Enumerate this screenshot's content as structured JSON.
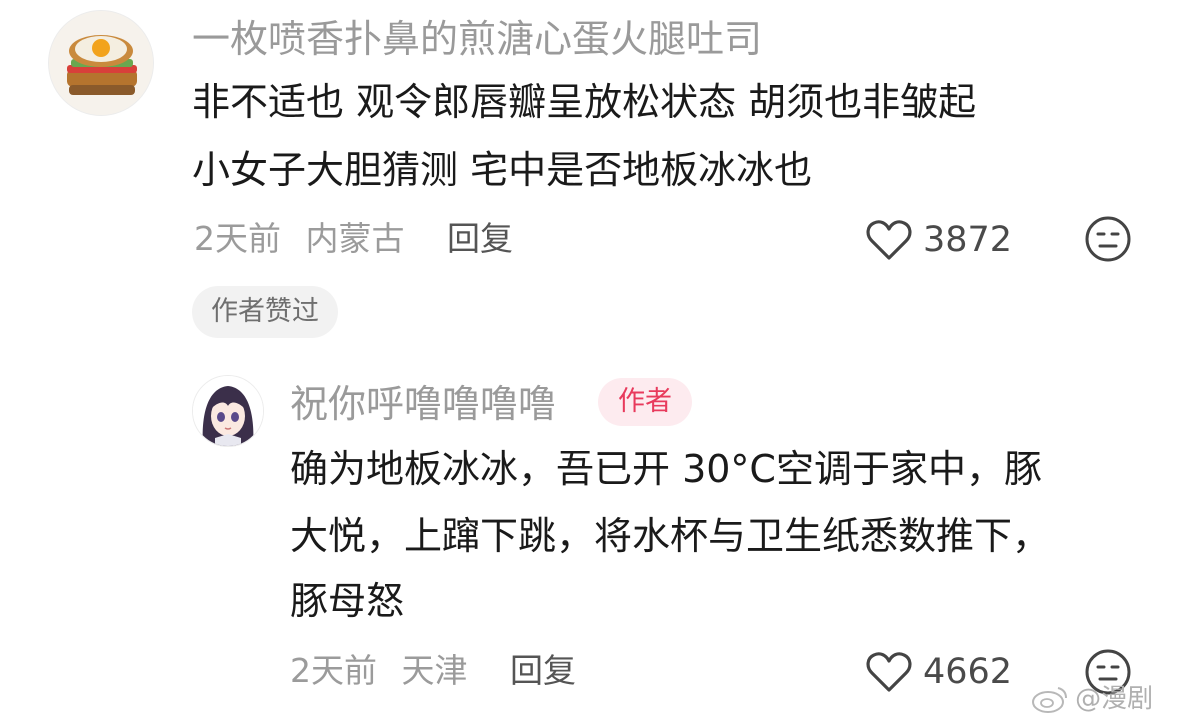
{
  "colors": {
    "accent": "#e83a5c",
    "meta_gray": "#9b9b9b",
    "text": "#1a1a1a",
    "badge_bg": "#f2f2f2",
    "author_badge_bg": "#fdebef"
  },
  "comment": {
    "avatar_icon": "toast-avatar-icon",
    "username": "一枚喷香扑鼻的煎溏心蛋火腿吐司",
    "lines": [
      "非不适也 观令郎唇瓣呈放松状态 胡须也非皱起",
      "小女子大胆猜测 宅中是否地板冰冰也"
    ],
    "time": "2天前",
    "location": "内蒙古",
    "reply_label": "回复",
    "like_count": "3872",
    "badge": "作者赞过"
  },
  "reply": {
    "avatar_icon": "anime-girl-avatar-icon",
    "username": "祝你呼噜噜噜噜",
    "author_badge": "作者",
    "lines": [
      "确为地板冰冰，吾已开 30°C空调于家中，豚",
      "大悦，上蹿下跳，将水杯与卫生纸悉数推下，",
      "豚母怒"
    ],
    "time": "2天前",
    "location": "天津",
    "reply_label": "回复",
    "like_count": "4662"
  },
  "watermark": "@漫剧"
}
